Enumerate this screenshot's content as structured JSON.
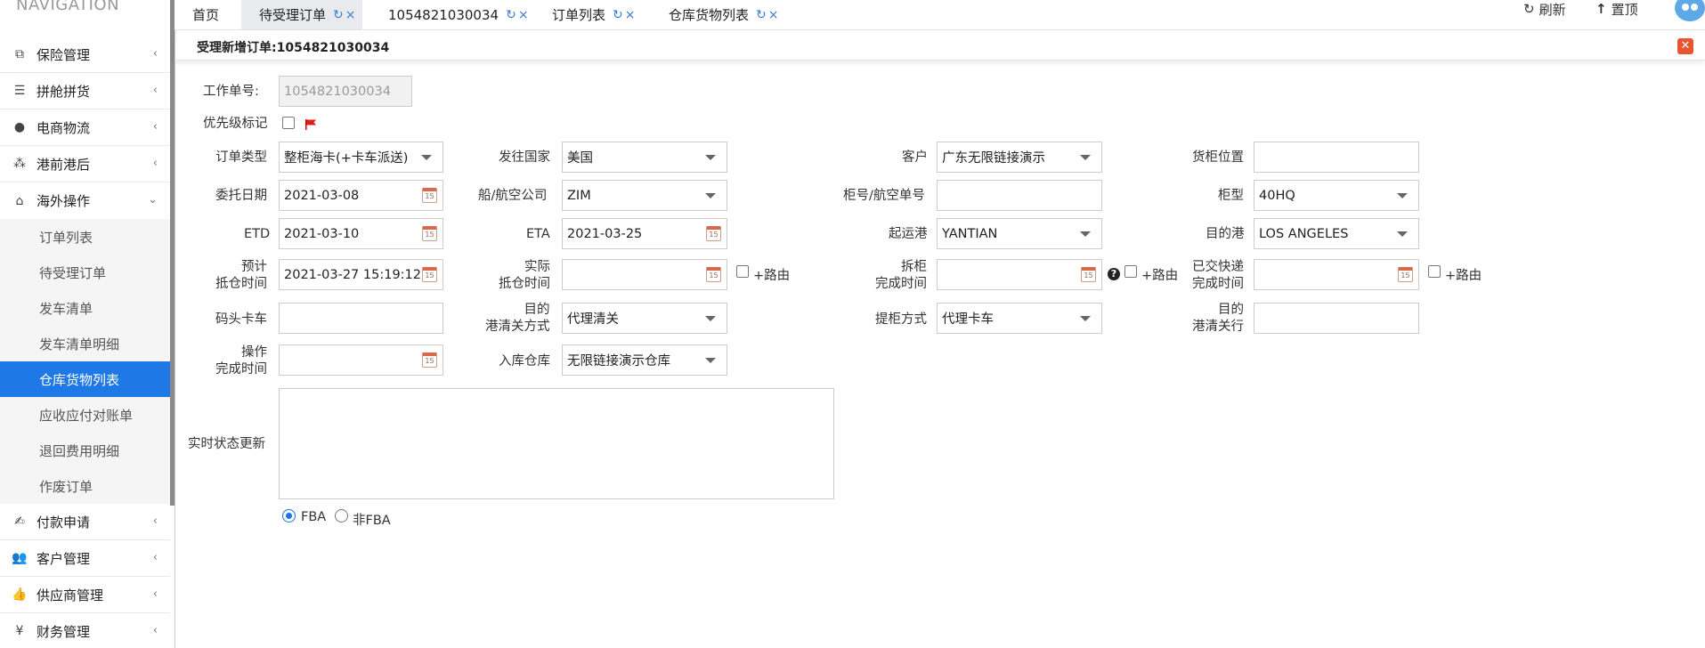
{
  "sidebar": {
    "title": "NAVIGATION",
    "menu": [
      {
        "label": "保险管理",
        "icon": "clipboard-icon",
        "glyph": "⧉"
      },
      {
        "label": "拼舱拼货",
        "icon": "server-icon",
        "glyph": "☰"
      },
      {
        "label": "电商物流",
        "icon": "globe-icon",
        "glyph": "●"
      },
      {
        "label": "港前港后",
        "icon": "cubes-icon",
        "glyph": "⁂"
      },
      {
        "label": "海外操作",
        "icon": "bank-icon",
        "glyph": "⌂"
      }
    ],
    "sub_items": [
      "订单列表",
      "待受理订单",
      "发车清单",
      "发车清单明细",
      "仓库货物列表",
      "应收应付对账单",
      "退回费用明细",
      "作废订单"
    ],
    "menu_bottom": [
      {
        "label": "付款申请",
        "icon": "handshake-icon",
        "glyph": "✍"
      },
      {
        "label": "客户管理",
        "icon": "users-icon",
        "glyph": "👥"
      },
      {
        "label": "供应商管理",
        "icon": "thumbs-up-icon",
        "glyph": "👍"
      },
      {
        "label": "财务管理",
        "icon": "yen-icon",
        "glyph": "¥"
      }
    ]
  },
  "tabs": [
    "首页",
    "待受理订单",
    "1054821030034",
    "订单列表",
    "仓库货物列表"
  ],
  "top_actions": {
    "refresh": "刷新",
    "top": "置顶"
  },
  "panel": {
    "title": "受理新增订单:1054821030034"
  },
  "form": {
    "work_order_label": "工作单号:",
    "work_order_value": "1054821030034",
    "priority_label": "优先级标记",
    "order_type_label": "订单类型",
    "order_type_value": "整柜海卡(+卡车派送)",
    "dest_country_label": "发往国家",
    "dest_country_value": "美国",
    "customer_label": "客户",
    "customer_value": "广东无限链接演示",
    "container_loc_label": "货柜位置",
    "container_loc_value": "",
    "entrust_date_label": "委托日期",
    "entrust_date_value": "2021-03-08",
    "carrier_label": "船/航空公司",
    "carrier_value": "ZIM",
    "container_no_label": "柜号/航空单号",
    "container_no_value": "",
    "container_type_label": "柜型",
    "container_type_value": "40HQ",
    "etd_label": "ETD",
    "etd_value": "2021-03-10",
    "eta_label": "ETA",
    "eta_value": "2021-03-25",
    "origin_port_label": "起运港",
    "origin_port_value": "YANTIAN",
    "dest_port_label": "目的港",
    "dest_port_value": "LOS ANGELES",
    "est_arrival_label_1": "预计",
    "est_arrival_label_2": "抵仓时间",
    "est_arrival_value": "2021-03-27 15:19:12",
    "act_arrival_label_1": "实际",
    "act_arrival_label_2": "抵仓时间",
    "act_arrival_value": "",
    "route_label": "+路由",
    "unpack_label_1": "拆柜",
    "unpack_label_2": "完成时间",
    "unpack_value": "",
    "express_label_1": "已交快递",
    "express_label_2": "完成时间",
    "express_value": "",
    "dock_truck_label": "码头卡车",
    "dock_truck_value": "",
    "customs_method_label_1": "目的",
    "customs_method_label_2": "港清关方式",
    "customs_method_value": "代理清关",
    "pickup_method_label": "提柜方式",
    "pickup_method_value": "代理卡车",
    "customs_broker_label_1": "目的",
    "customs_broker_label_2": "港清关行",
    "customs_broker_value": "",
    "op_done_label_1": "操作",
    "op_done_label_2": "完成时间",
    "op_done_value": "",
    "warehouse_label": "入库仓库",
    "warehouse_value": "无限链接演示仓库",
    "status_label": "实时状态更新",
    "status_value": "",
    "radio_fba": "FBA",
    "radio_non_fba": "非FBA",
    "calendar_glyph": "15"
  }
}
